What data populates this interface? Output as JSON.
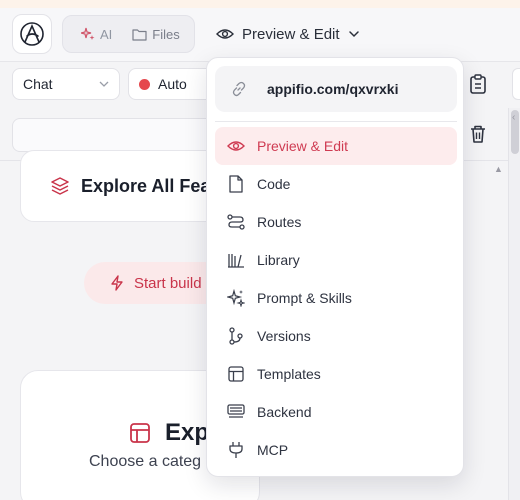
{
  "topbar": {
    "segments": [
      {
        "icon": "sparkle-icon",
        "label": "AI"
      },
      {
        "icon": "folder-icon",
        "label": "Files"
      }
    ],
    "view_selector": {
      "icon": "eye-icon",
      "label": "Preview & Edit"
    }
  },
  "toolbar": {
    "chat_select": "Chat",
    "auto_select": "Auto",
    "status_color": "#e5484d"
  },
  "content": {
    "feature_card_title": "Explore All Fea",
    "start_button": "Start build",
    "explore_title": "Exp",
    "explore_subtitle": "Choose a categ"
  },
  "dropdown": {
    "url": "appifio.com/qxvrxki",
    "items": [
      {
        "label": "Preview & Edit",
        "icon": "eye-icon",
        "active": true
      },
      {
        "label": "Code",
        "icon": "file-icon"
      },
      {
        "label": "Routes",
        "icon": "route-icon"
      },
      {
        "label": "Library",
        "icon": "library-icon"
      },
      {
        "label": "Prompt & Skills",
        "icon": "sparkles-icon"
      },
      {
        "label": "Versions",
        "icon": "git-branch-icon"
      },
      {
        "label": "Templates",
        "icon": "layout-icon"
      },
      {
        "label": "Backend",
        "icon": "server-icon"
      },
      {
        "label": "MCP",
        "icon": "plug-icon"
      }
    ]
  },
  "colors": {
    "accent": "#cf3b52",
    "accent_bg": "#fdeced"
  }
}
